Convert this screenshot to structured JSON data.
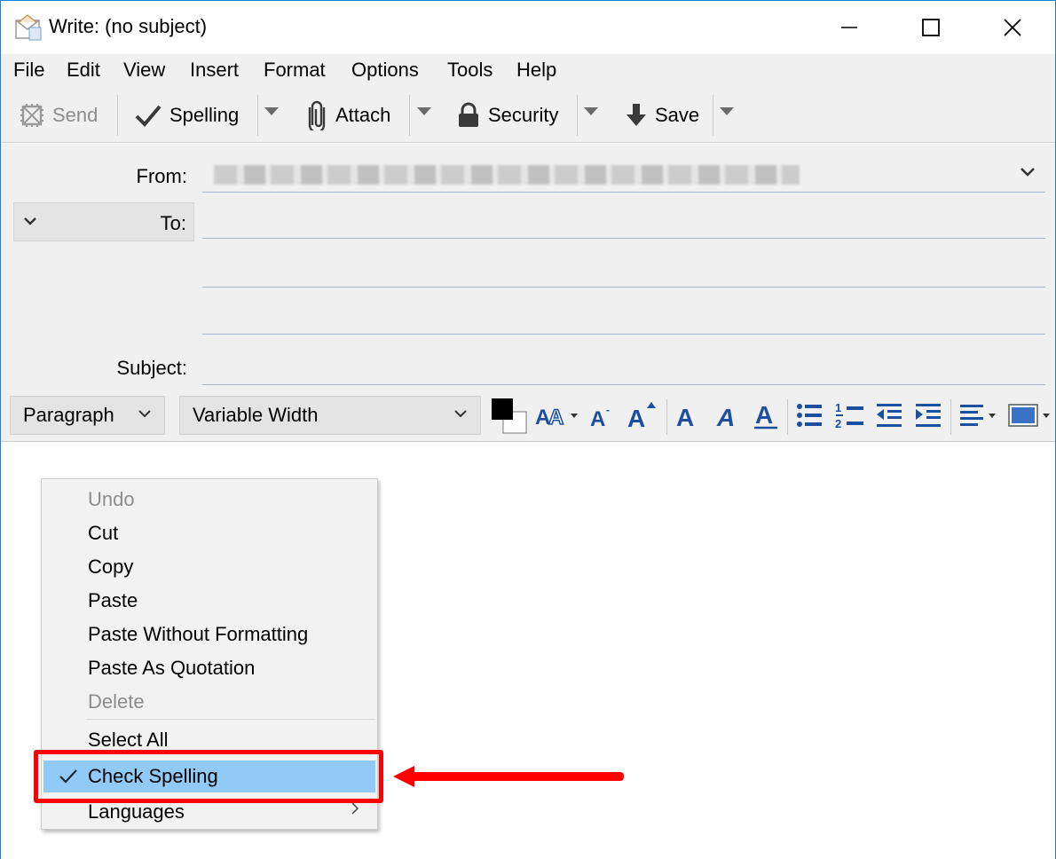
{
  "window": {
    "title": "Write: (no subject)"
  },
  "menubar": {
    "items": [
      "File",
      "Edit",
      "View",
      "Insert",
      "Format",
      "Options",
      "Tools",
      "Help"
    ]
  },
  "toolbar": {
    "send_label": "Send",
    "spelling_label": "Spelling",
    "attach_label": "Attach",
    "security_label": "Security",
    "save_label": "Save"
  },
  "headers": {
    "from_label": "From:",
    "to_label": "To:",
    "subject_label": "Subject:"
  },
  "format_bar": {
    "paragraph_value": "Paragraph",
    "font_value": "Variable Width"
  },
  "context_menu": {
    "items": [
      {
        "label": "Undo",
        "disabled": true
      },
      {
        "label": "Cut",
        "disabled": false
      },
      {
        "label": "Copy",
        "disabled": false
      },
      {
        "label": "Paste",
        "disabled": false
      },
      {
        "label": "Paste Without Formatting",
        "disabled": false
      },
      {
        "label": "Paste As Quotation",
        "disabled": false
      },
      {
        "label": "Delete",
        "disabled": true
      },
      {
        "label": "Select All",
        "disabled": false
      },
      {
        "label": "Check Spelling",
        "disabled": false,
        "checked": true,
        "highlighted": true
      },
      {
        "label": "Languages",
        "disabled": false,
        "submenu": true
      }
    ]
  },
  "colors": {
    "highlight": "#91c9f7",
    "annotation": "#ff0000",
    "format_icon": "#1c4fa0",
    "window_border": "#1883d7"
  },
  "icons": {
    "title": "mail-compose-icon",
    "send": "send-icon",
    "spelling": "checkmark-icon",
    "attach": "paperclip-icon",
    "security": "lock-icon",
    "save": "download-arrow-icon"
  }
}
